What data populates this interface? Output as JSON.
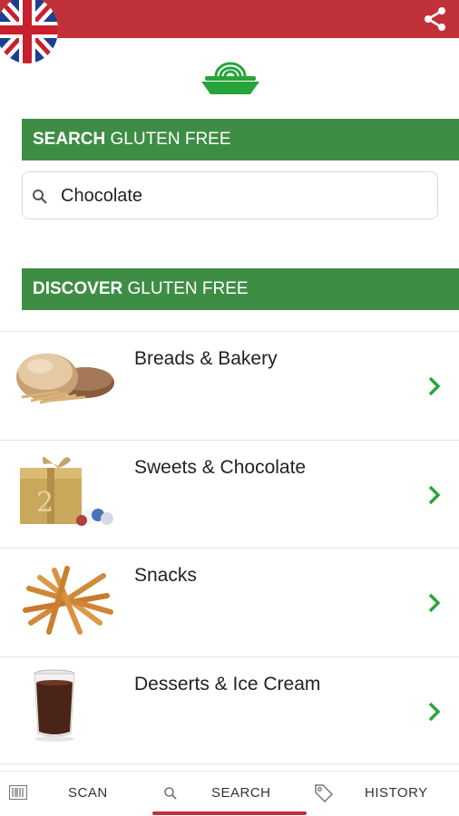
{
  "header": {
    "language_flag": "uk-flag-icon",
    "share_icon": "share-icon",
    "brand_color": "#c0313a",
    "logo_icon": "gluten-free-bowl-logo-icon"
  },
  "search_section": {
    "title_bold": "SEARCH",
    "title_rest": " GLUTEN FREE",
    "input_value": "Chocolate",
    "search_icon": "search-icon",
    "header_color": "#3e8d45"
  },
  "discover_section": {
    "title_bold": "DISCOVER",
    "title_rest": " GLUTEN FREE",
    "categories": [
      {
        "label": "Breads & Bakery",
        "icon": "bread-image"
      },
      {
        "label": "Sweets & Chocolate",
        "icon": "chocolate-gift-box-image"
      },
      {
        "label": "Snacks",
        "icon": "breadsticks-image"
      },
      {
        "label": "Desserts & Ice Cream",
        "icon": "chocolate-dessert-glass-image"
      }
    ]
  },
  "bottom_nav": {
    "items": [
      {
        "label": "SCAN",
        "icon": "barcode-icon"
      },
      {
        "label": "SEARCH",
        "icon": "search-icon",
        "active": true
      },
      {
        "label": "HISTORY",
        "icon": "tag-icon"
      }
    ]
  }
}
